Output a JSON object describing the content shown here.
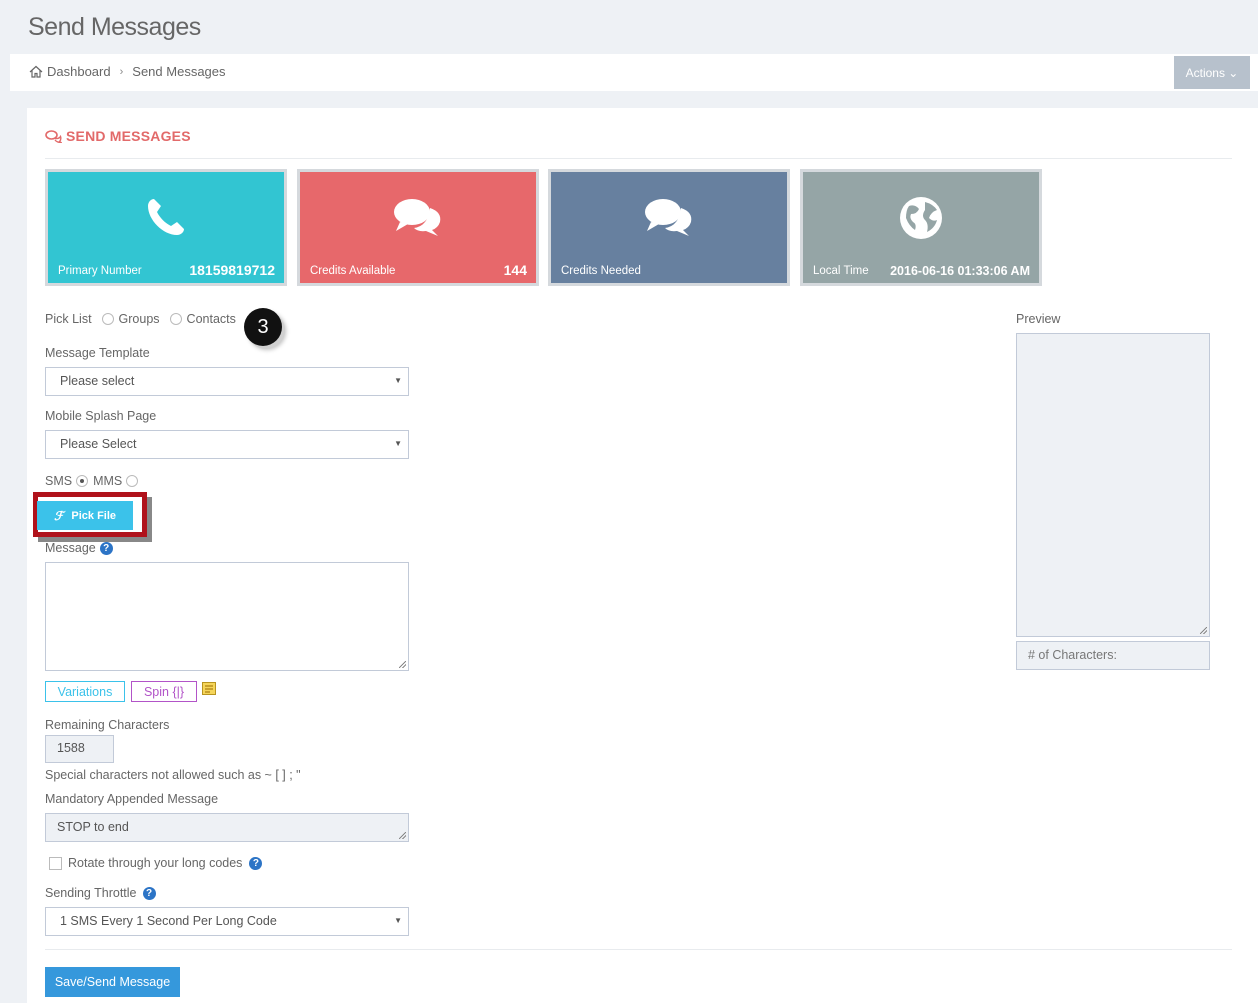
{
  "page": {
    "title": "Send Messages"
  },
  "breadcrumb": {
    "home": "Dashboard",
    "current": "Send Messages"
  },
  "actions": {
    "label": "Actions ⌄"
  },
  "section": {
    "title": "SEND MESSAGES"
  },
  "stats": [
    {
      "label": "Primary Number",
      "value": "18159819712",
      "color": "#32c5d2",
      "icon": "phone-icon"
    },
    {
      "label": "Credits Available",
      "value": "144",
      "color": "#e7686b",
      "icon": "chat-bubbles-icon"
    },
    {
      "label": "Credits Needed",
      "value": "",
      "color": "#67809f",
      "icon": "chat-bubbles-icon"
    },
    {
      "label": "Local Time",
      "value": "2016-06-16 01:33:06 AM",
      "color": "#95a5a6",
      "icon": "globe-icon"
    }
  ],
  "pick_list": {
    "label": "Pick List",
    "options": [
      "Groups",
      "Contacts"
    ]
  },
  "step_badge": "3",
  "message_template": {
    "label": "Message Template",
    "value": "Please select"
  },
  "splash_page": {
    "label": "Mobile Splash Page",
    "value": "Please Select"
  },
  "message_type": {
    "sms": "SMS",
    "mms": "MMS",
    "selected": "SMS"
  },
  "pick_file": {
    "label": "Pick File"
  },
  "message": {
    "label": "Message",
    "value": ""
  },
  "variations": {
    "label": "Variations"
  },
  "spin": {
    "label": "Spin {|}"
  },
  "remaining": {
    "label": "Remaining Characters",
    "value": "1588"
  },
  "special_note": "Special characters not allowed such as ~ [ ] ; \"",
  "appended": {
    "label": "Mandatory Appended Message",
    "value": "STOP to end"
  },
  "rotate": {
    "label": "Rotate through your long codes"
  },
  "throttle": {
    "label": "Sending Throttle",
    "value": "1 SMS Every 1 Second Per Long Code"
  },
  "save": {
    "label": "Save/Send Message"
  },
  "preview": {
    "label": "Preview",
    "char_count": "# of Characters:"
  }
}
